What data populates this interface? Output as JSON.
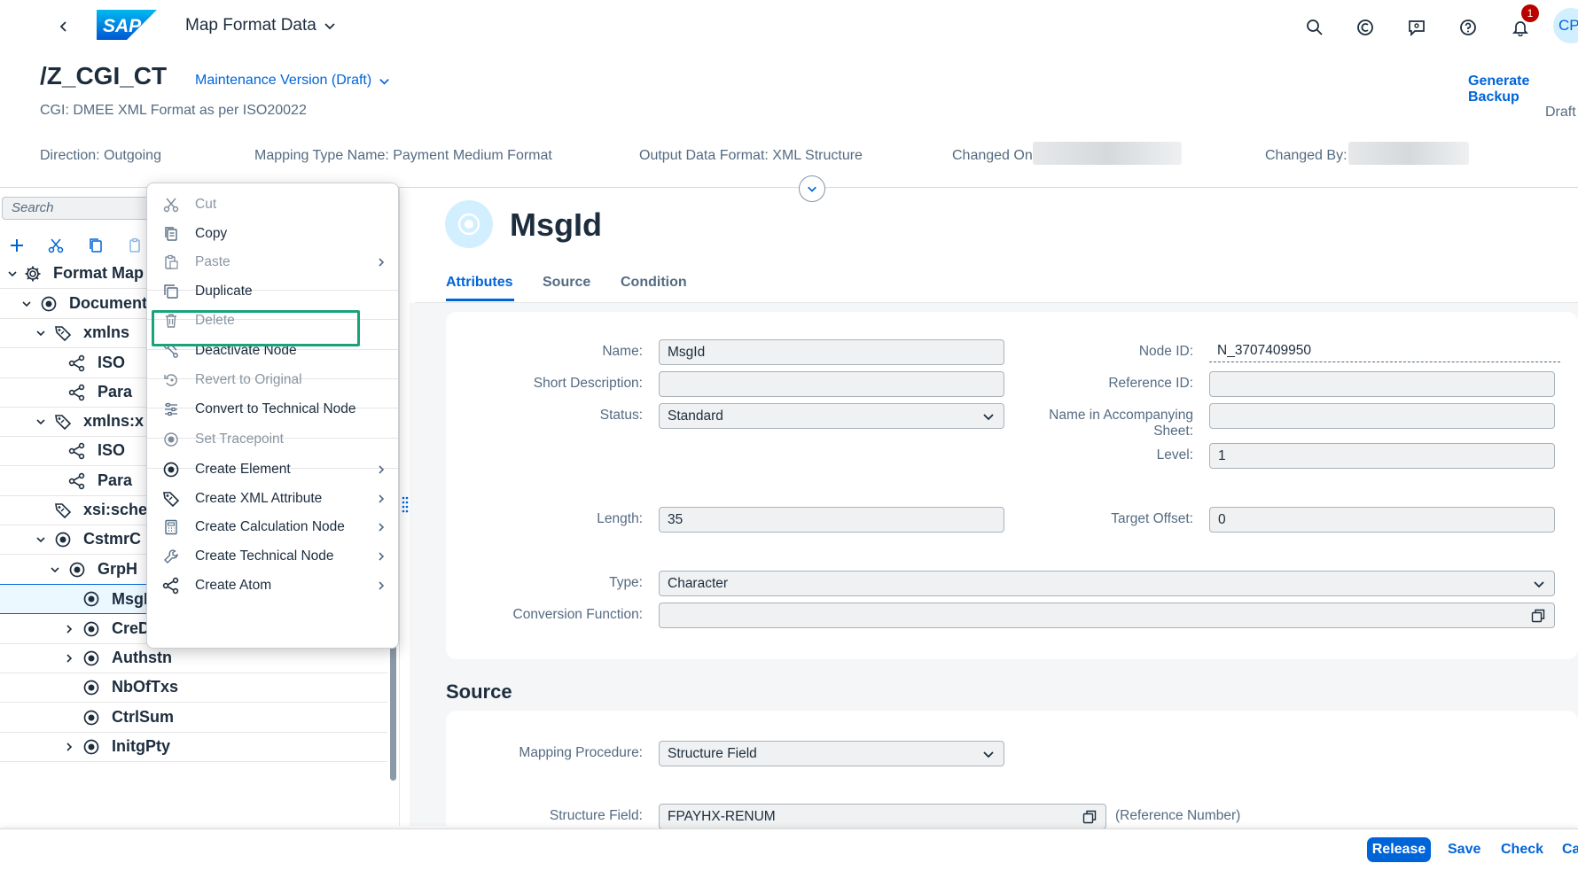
{
  "shell": {
    "logo_text": "SAP",
    "app_title": "Map Format Data",
    "badge_count": "1",
    "avatar_initials": "CP"
  },
  "header": {
    "object_title": "/Z_CGI_CT",
    "version": "Maintenance Version (Draft)",
    "subtitle": "CGI: DMEE XML Format as per ISO20022",
    "generate_backup": "Generate Backup",
    "status": "Draft",
    "attributes": [
      {
        "label": "Direction: Outgoing"
      },
      {
        "label": "Mapping Type Name: Payment Medium Format"
      },
      {
        "label": "Output Data Format: XML Structure"
      },
      {
        "label": "Changed On:"
      },
      {
        "label": "Changed By:"
      }
    ]
  },
  "tree": {
    "search_placeholder": "Search",
    "rows": [
      {
        "label": "Format Map",
        "icon": "gear-icon",
        "expanded": true
      },
      {
        "label": "Document",
        "icon": "element-icon",
        "expanded": true
      },
      {
        "label": "xmlns",
        "icon": "tag-icon",
        "expanded": true
      },
      {
        "label": "ISO",
        "icon": "atom-icon"
      },
      {
        "label": "Para",
        "icon": "atom-icon"
      },
      {
        "label": "xmlns:x",
        "icon": "tag-icon",
        "expanded": true
      },
      {
        "label": "ISO",
        "icon": "atom-icon"
      },
      {
        "label": "Para",
        "icon": "atom-icon"
      },
      {
        "label": "xsi:sche",
        "icon": "tag-icon"
      },
      {
        "label": "CstmrC",
        "icon": "element-icon",
        "expanded": true
      },
      {
        "label": "GrpH",
        "icon": "element-icon",
        "expanded": true
      },
      {
        "label": "MsgId",
        "icon": "element-icon",
        "selected": true
      },
      {
        "label": "CreDtTm",
        "icon": "element-icon",
        "expanded": false
      },
      {
        "label": "Authstn",
        "icon": "element-icon",
        "expanded": false
      },
      {
        "label": "NbOfTxs",
        "icon": "element-icon"
      },
      {
        "label": "CtrlSum",
        "icon": "element-icon"
      },
      {
        "label": "InitgPty",
        "icon": "element-icon",
        "expanded": false
      }
    ]
  },
  "context_menu": {
    "items": [
      {
        "label": "Cut",
        "icon": "scissors-icon",
        "disabled": true
      },
      {
        "label": "Copy",
        "icon": "copy-icon"
      },
      {
        "label": "Paste",
        "icon": "paste-icon",
        "disabled": true,
        "submenu": true
      },
      {
        "label": "Duplicate",
        "icon": "duplicate-icon"
      },
      {
        "label": "Delete",
        "icon": "trash-icon",
        "disabled": true
      },
      {
        "label": "Deactivate Node",
        "icon": "deactivate-icon"
      },
      {
        "label": "Revert to Original",
        "icon": "revert-icon",
        "disabled": true
      },
      {
        "label": "Convert to Technical Node",
        "icon": "convert-icon"
      },
      {
        "label": "Set Tracepoint",
        "icon": "tracepoint-icon",
        "disabled": true
      },
      {
        "label": "Create Element",
        "icon": "element-icon",
        "submenu": true
      },
      {
        "label": "Create XML Attribute",
        "icon": "tag-icon",
        "submenu": true
      },
      {
        "label": "Create Calculation Node",
        "icon": "calculator-icon",
        "submenu": true
      },
      {
        "label": "Create Technical Node",
        "icon": "wrench-icon",
        "submenu": true
      },
      {
        "label": "Create Atom",
        "icon": "atom-icon",
        "submenu": true
      }
    ]
  },
  "detail": {
    "title": "MsgId",
    "tabs": [
      "Attributes",
      "Source",
      "Condition"
    ],
    "fields": {
      "name": {
        "label": "Name:",
        "value": "MsgId"
      },
      "short_description": {
        "label": "Short Description:",
        "value": ""
      },
      "status": {
        "label": "Status:",
        "value": "Standard"
      },
      "node_id": {
        "label": "Node ID:",
        "value": "N_3707409950"
      },
      "reference_id": {
        "label": "Reference ID:",
        "value": ""
      },
      "name_in_sheet": {
        "label_line1": "Name in Accompanying",
        "label_line2": "Sheet:",
        "value": ""
      },
      "level": {
        "label": "Level:",
        "value": "1"
      },
      "length": {
        "label": "Length:",
        "value": "35"
      },
      "target_offset": {
        "label": "Target Offset:",
        "value": "0"
      },
      "type": {
        "label": "Type:",
        "value": "Character"
      },
      "conversion_function": {
        "label": "Conversion Function:",
        "value": ""
      }
    },
    "source": {
      "title": "Source",
      "mapping_procedure": {
        "label": "Mapping Procedure:",
        "value": "Structure Field"
      },
      "structure_field": {
        "label": "Structure Field:",
        "value": "FPAYHX-RENUM",
        "description": "(Reference Number)"
      }
    }
  },
  "footer": {
    "release": "Release",
    "save": "Save",
    "check": "Check",
    "cancel": "Ca"
  },
  "colors": {
    "brand": "#0064d9",
    "text": "#1d2d3e",
    "muted": "#556b82",
    "highlight_box": "#1aa37a",
    "badge": "#bb0000"
  }
}
